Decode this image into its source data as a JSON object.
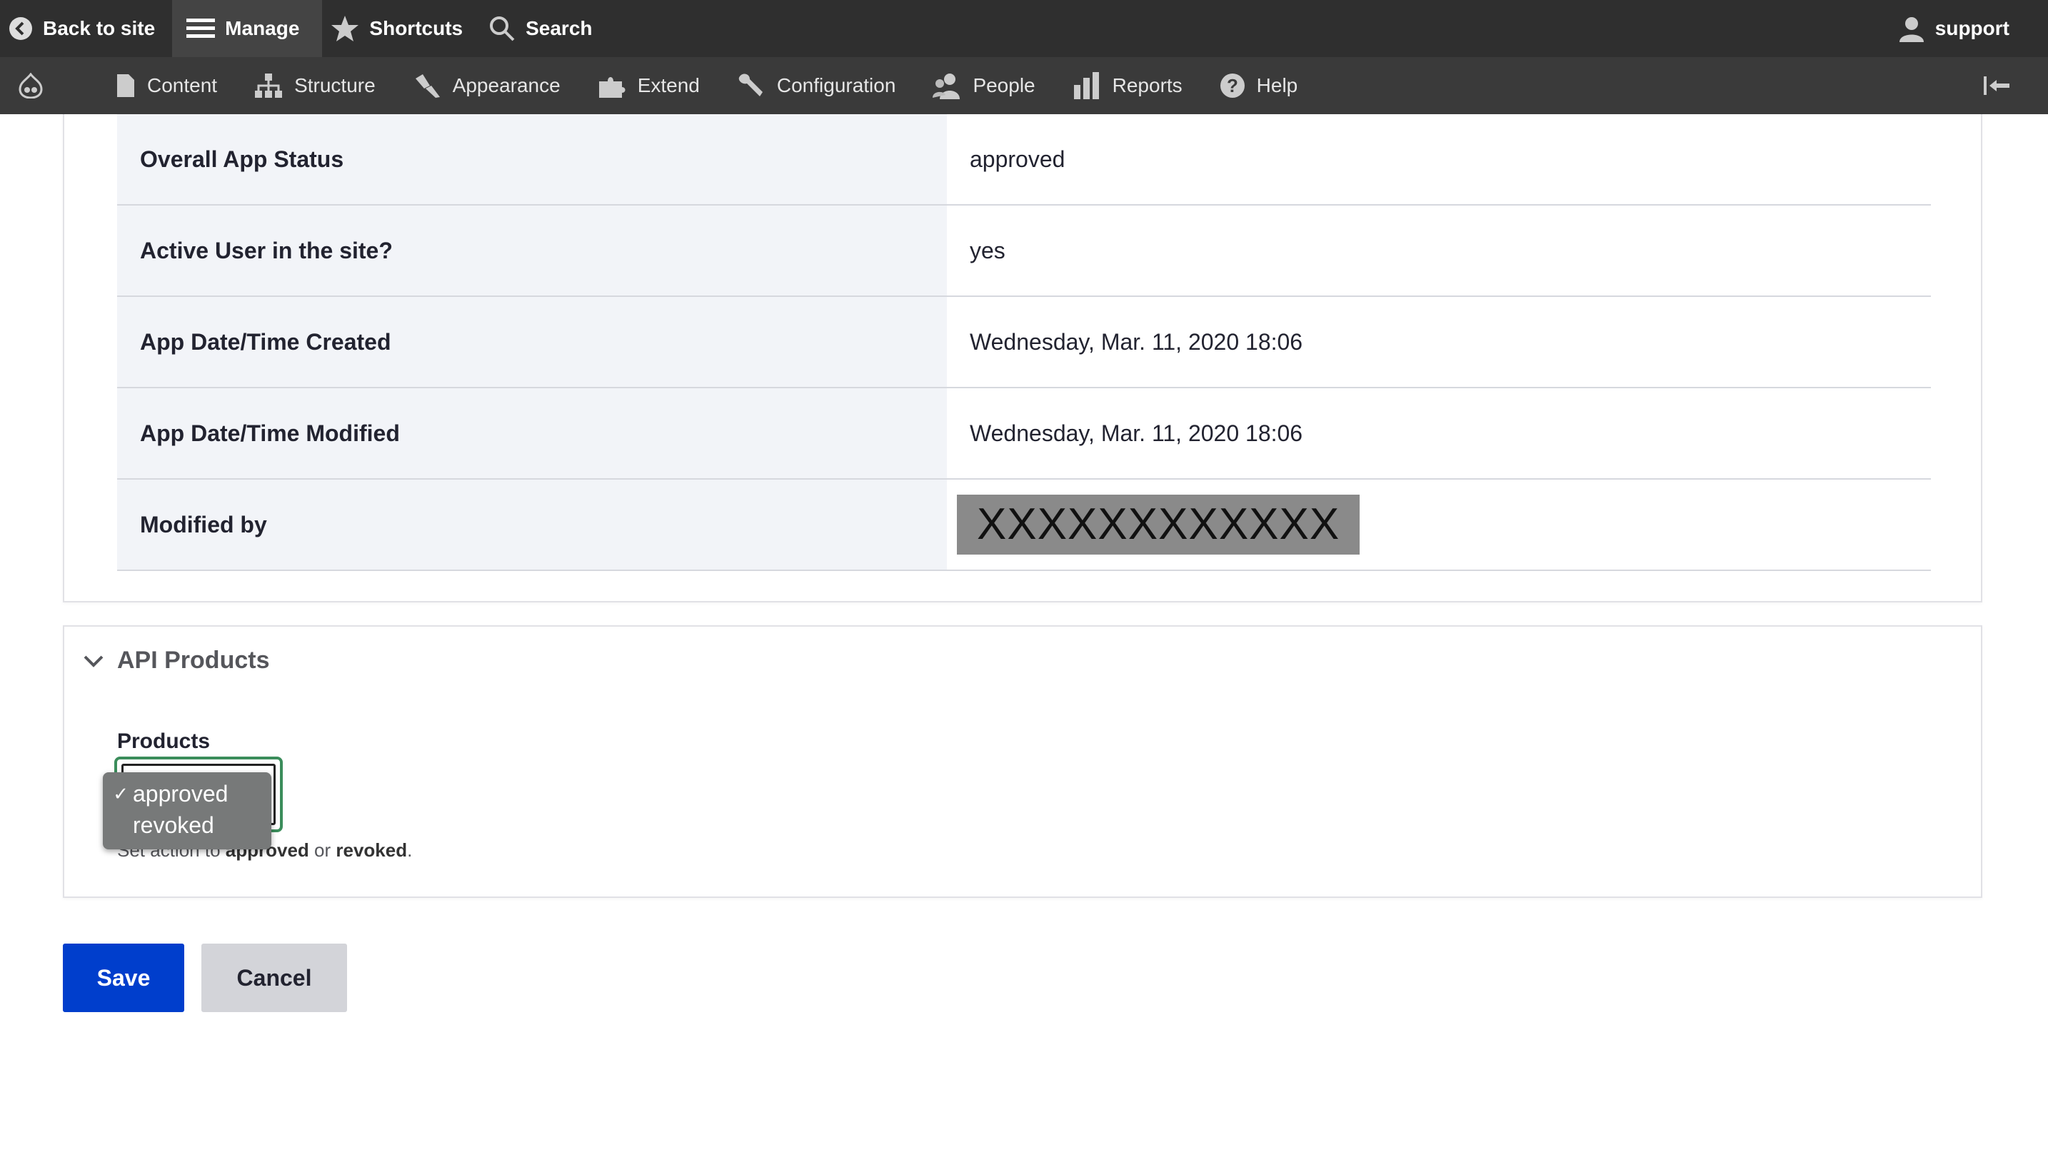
{
  "topbar": {
    "back_to_site": "Back to site",
    "manage": "Manage",
    "shortcuts": "Shortcuts",
    "search": "Search",
    "user": "support"
  },
  "admin_menu": {
    "items": [
      {
        "label": "Content",
        "icon": "file-icon"
      },
      {
        "label": "Structure",
        "icon": "sitemap-icon"
      },
      {
        "label": "Appearance",
        "icon": "paintbrush-icon"
      },
      {
        "label": "Extend",
        "icon": "puzzle-icon"
      },
      {
        "label": "Configuration",
        "icon": "wrench-icon"
      },
      {
        "label": "People",
        "icon": "people-icon"
      },
      {
        "label": "Reports",
        "icon": "bar-chart-icon"
      },
      {
        "label": "Help",
        "icon": "help-icon"
      }
    ]
  },
  "details": {
    "rows": [
      {
        "label": "Overall App Status",
        "value": "approved"
      },
      {
        "label": "Active User in the site?",
        "value": "yes"
      },
      {
        "label": "App Date/Time Created",
        "value": "Wednesday, Mar. 11, 2020 18:06"
      },
      {
        "label": "App Date/Time Modified",
        "value": "Wednesday, Mar. 11, 2020 18:06"
      },
      {
        "label": "Modified by",
        "value": "XXXXXXXXXXXX"
      }
    ]
  },
  "api_products": {
    "summary": "API Products",
    "field_label": "Products",
    "options": [
      "approved",
      "revoked"
    ],
    "selected": "approved",
    "description_prefix": "Set action to ",
    "description_approved": "approved",
    "description_or": " or ",
    "description_revoked": "revoked",
    "description_suffix": "."
  },
  "actions": {
    "save": "Save",
    "cancel": "Cancel"
  },
  "colors": {
    "primary": "#003ecc",
    "focus": "#3b8d5b",
    "toolbar": "#2f2f2f"
  }
}
